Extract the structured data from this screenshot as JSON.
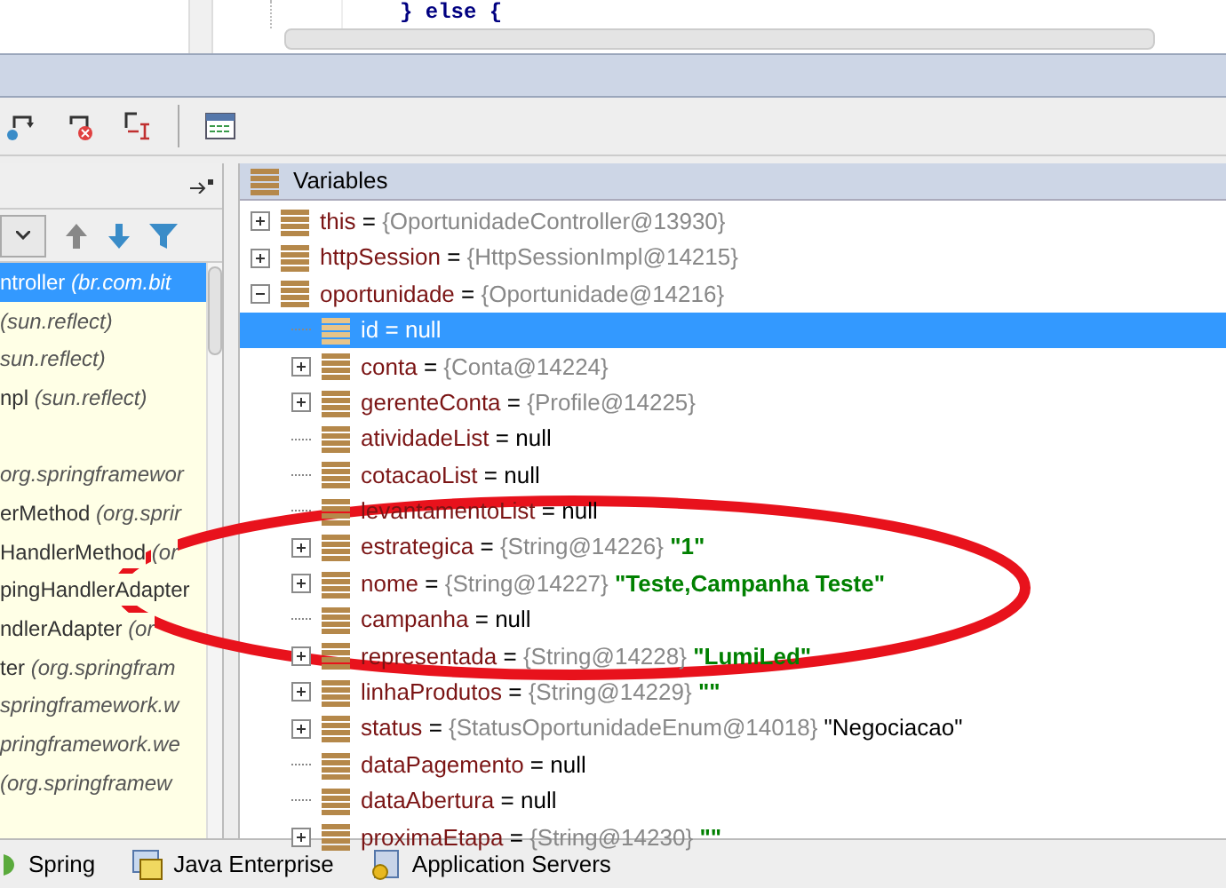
{
  "editor": {
    "code_line": "} else {"
  },
  "frames": [
    {
      "method": "ntroller",
      "package": "(br.com.bit",
      "selected": true
    },
    {
      "package": "(sun.reflect)",
      "selected": false
    },
    {
      "package": "sun.reflect)",
      "selected": false
    },
    {
      "method": "npl",
      "package": "(sun.reflect)",
      "selected": false
    },
    {
      "selected": false
    },
    {
      "package": "org.springframewor",
      "selected": false
    },
    {
      "method": "erMethod",
      "package": "(org.sprir",
      "selected": false
    },
    {
      "method": "HandlerMethod",
      "package": "(or",
      "selected": false
    },
    {
      "method": "pingHandlerAdapter",
      "selected": false
    },
    {
      "method": "ndlerAdapter",
      "package": "(or",
      "selected": false
    },
    {
      "method": "ter",
      "package": "(org.springfram",
      "selected": false
    },
    {
      "package": "springframework.w",
      "selected": false
    },
    {
      "package": "pringframework.we",
      "selected": false
    },
    {
      "package": "(org.springframew",
      "selected": false
    }
  ],
  "variables": {
    "title": "Variables",
    "items": [
      {
        "name": "this",
        "operator": "=",
        "type": "{OportunidadeController@13930}",
        "expandable": true,
        "expanded": false,
        "selected": false
      },
      {
        "name": "httpSession",
        "operator": "=",
        "type": "{HttpSessionImpl@14215}",
        "expandable": true,
        "expanded": false,
        "selected": false
      },
      {
        "name": "oportunidade",
        "operator": "=",
        "type": "{Oportunidade@14216}",
        "expandable": true,
        "expanded": true,
        "selected": false,
        "children": [
          {
            "name": "id",
            "operator": "=",
            "value": "null",
            "string_value": false,
            "expandable": false,
            "selected": true
          },
          {
            "name": "conta",
            "operator": "=",
            "type": "{Conta@14224}",
            "expandable": true,
            "expanded": false,
            "selected": false
          },
          {
            "name": "gerenteConta",
            "operator": "=",
            "type": "{Profile@14225}",
            "expandable": true,
            "expanded": false,
            "selected": false
          },
          {
            "name": "atividadeList",
            "operator": "=",
            "value": "null",
            "string_value": false,
            "expandable": false,
            "selected": false
          },
          {
            "name": "cotacaoList",
            "operator": "=",
            "value": "null",
            "string_value": false,
            "expandable": false,
            "selected": false
          },
          {
            "name": "levantamentoList",
            "operator": "=",
            "value": "null",
            "string_value": false,
            "expandable": false,
            "selected": false
          },
          {
            "name": "estrategica",
            "operator": "=",
            "type": "{String@14226}",
            "value": "\"1\"",
            "string_value": true,
            "expandable": true,
            "expanded": false,
            "selected": false
          },
          {
            "name": "nome",
            "operator": "=",
            "type": "{String@14227}",
            "value": "\"Teste,Campanha Teste\"",
            "string_value": true,
            "expandable": true,
            "expanded": false,
            "selected": false
          },
          {
            "name": "campanha",
            "operator": "=",
            "value": "null",
            "string_value": false,
            "expandable": false,
            "selected": false
          },
          {
            "name": "representada",
            "operator": "=",
            "type": "{String@14228}",
            "value": "\"LumiLed\"",
            "string_value": true,
            "expandable": true,
            "expanded": false,
            "selected": false
          },
          {
            "name": "linhaProdutos",
            "operator": "=",
            "type": "{String@14229}",
            "value": "\"\"",
            "string_value": true,
            "expandable": true,
            "expanded": false,
            "selected": false
          },
          {
            "name": "status",
            "operator": "=",
            "type": "{StatusOportunidadeEnum@14018}",
            "value": "\"Negociacao\"",
            "string_value": false,
            "expandable": true,
            "expanded": false,
            "selected": false
          },
          {
            "name": "dataPagemento",
            "operator": "=",
            "value": "null",
            "string_value": false,
            "expandable": false,
            "selected": false
          },
          {
            "name": "dataAbertura",
            "operator": "=",
            "value": "null",
            "string_value": false,
            "expandable": false,
            "selected": false
          },
          {
            "name": "proximaEtapa",
            "operator": "=",
            "type": "{String@14230}",
            "value": "\"\"",
            "string_value": true,
            "expandable": true,
            "expanded": false,
            "selected": false
          }
        ]
      }
    ]
  },
  "bottom_tabs": [
    {
      "label": "Spring",
      "kind": "spring"
    },
    {
      "label": "Java Enterprise",
      "kind": "javaee"
    },
    {
      "label": "Application Servers",
      "kind": "appservers"
    }
  ]
}
